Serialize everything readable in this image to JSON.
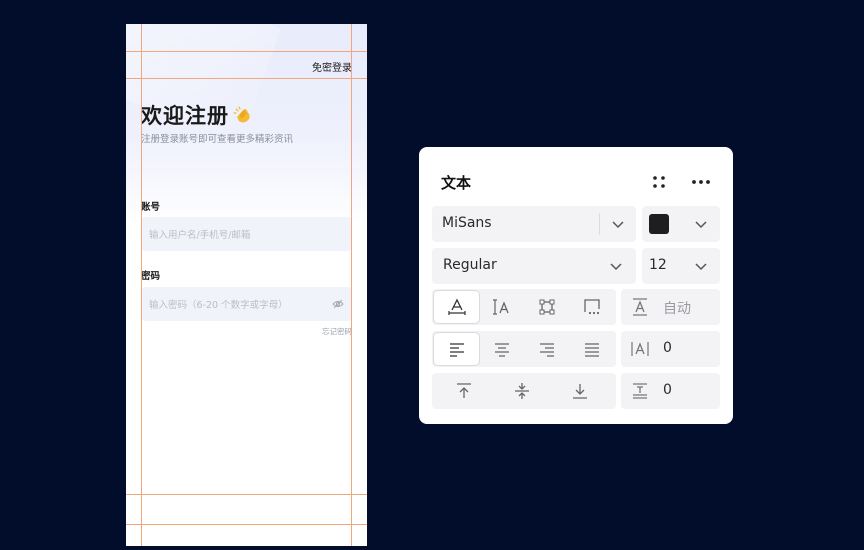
{
  "mockup": {
    "skip_login": "免密登录",
    "title": "欢迎注册",
    "subtitle": "注册登录账号即可查看更多精彩资讯",
    "account_label": "账号",
    "account_placeholder": "输入用户名/手机号/邮箱",
    "password_label": "密码",
    "password_placeholder": "输入密码（6-20 个数字或字母）",
    "forgot_password": "忘记密码"
  },
  "panel": {
    "title": "文本",
    "font_family": "MiSans",
    "font_weight": "Regular",
    "font_size": "12",
    "fill_color": "#1e1e1e",
    "auto_label": "自动",
    "letter_spacing": "0",
    "line_height": "0",
    "icons": [
      "drag-handle-icon",
      "more-icon",
      "chevron-down-icon",
      "text-auto-width-icon",
      "text-auto-height-icon",
      "text-fixed-size-icon",
      "text-truncate-icon",
      "baseline-icon",
      "align-left-icon",
      "align-center-icon",
      "align-right-icon",
      "align-justify-icon",
      "letter-spacing-icon",
      "valign-top-icon",
      "valign-middle-icon",
      "valign-bottom-icon",
      "line-height-icon"
    ]
  }
}
